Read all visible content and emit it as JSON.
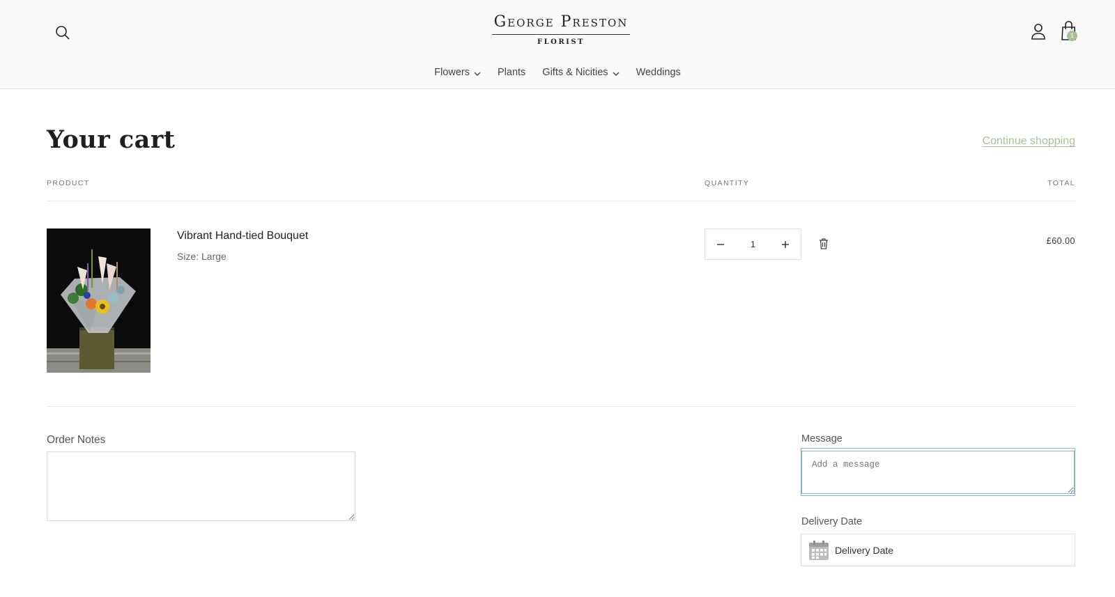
{
  "header": {
    "logo_main": "George Preston",
    "logo_sub": "FLORIST",
    "cart_count": "1",
    "nav": [
      {
        "label": "Flowers",
        "has_dropdown": true
      },
      {
        "label": "Plants",
        "has_dropdown": false
      },
      {
        "label": "Gifts & Nicities",
        "has_dropdown": true
      },
      {
        "label": "Weddings",
        "has_dropdown": false
      }
    ],
    "icons": {
      "search": "search-icon",
      "account": "account-icon",
      "cart": "cart-icon"
    }
  },
  "cart": {
    "title": "Your cart",
    "continue_label": "Continue shopping",
    "columns": {
      "product": "PRODUCT",
      "quantity": "QUANTITY",
      "total": "TOTAL"
    },
    "items": [
      {
        "name": "Vibrant Hand-tied Bouquet",
        "size": "Size: Large",
        "quantity": "1",
        "total": "£60.00"
      }
    ]
  },
  "notes": {
    "label": "Order Notes",
    "value": ""
  },
  "message": {
    "label": "Message",
    "placeholder": "Add a message"
  },
  "delivery": {
    "label": "Delivery Date",
    "placeholder": "Delivery Date"
  },
  "colors": {
    "accent": "#a7c197",
    "focus": "#7fb8d3"
  }
}
